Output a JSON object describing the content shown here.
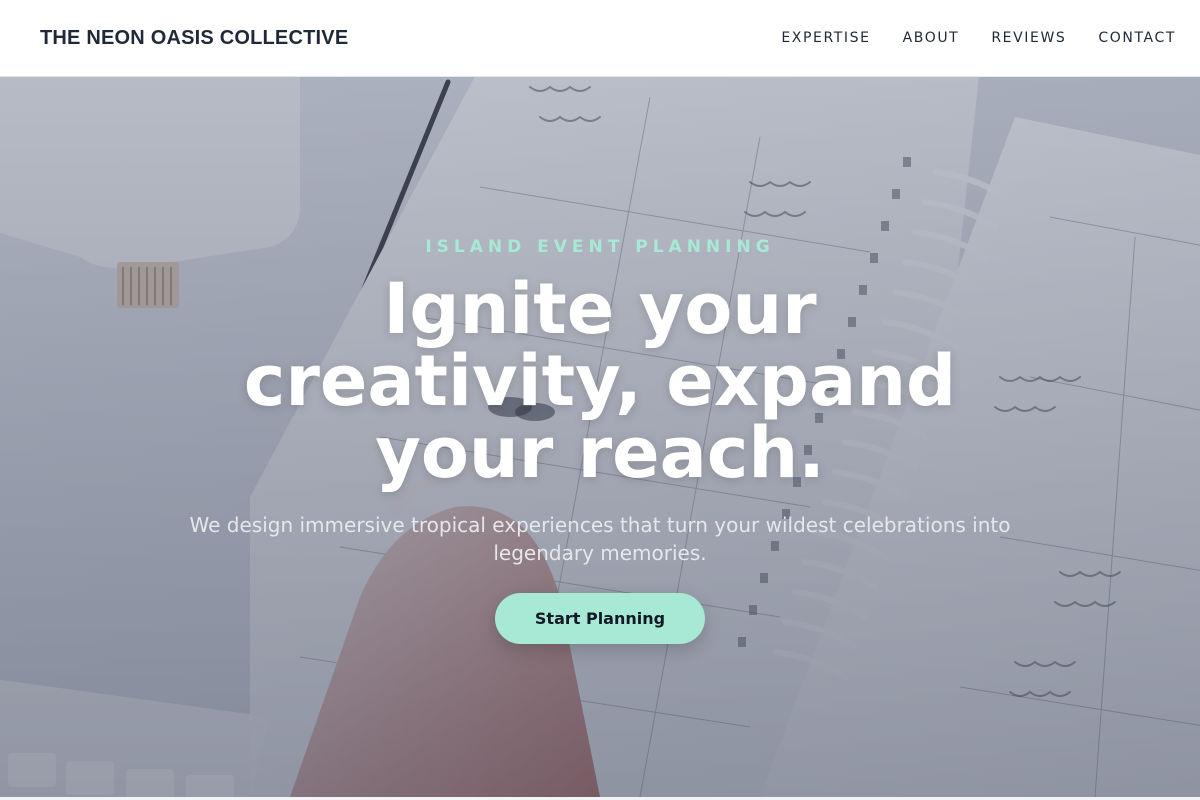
{
  "header": {
    "brand": "THE NEON OASIS COLLECTIVE",
    "nav": [
      "EXPERTISE",
      "ABOUT",
      "REVIEWS",
      "CONTACT"
    ]
  },
  "hero": {
    "kicker": "ISLAND EVENT PLANNING",
    "headline": "Ignite your creativity, expand your reach.",
    "subtext": "We design immersive tropical experiences that turn your wildest celebrations into legendary memories.",
    "cta_label": "Start Planning"
  },
  "colors": {
    "accent": "#a7e9d4",
    "text_dark": "#1f2937",
    "header_bg": "#ffffff"
  }
}
